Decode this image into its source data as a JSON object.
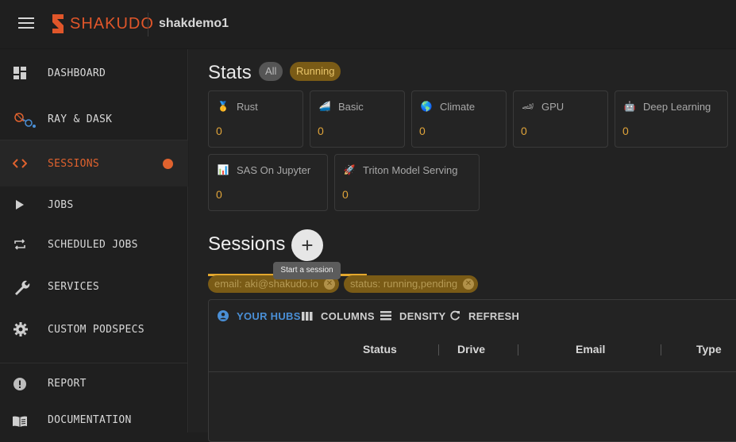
{
  "header": {
    "logo_text": "SHAKUDO",
    "workspace": "shakdemo1"
  },
  "sidebar": {
    "items": [
      {
        "label": "DASHBOARD",
        "icon": "dashboard-icon"
      },
      {
        "label": "RAY & DASK",
        "icon": "ray-dask-icon"
      },
      {
        "label": "SESSIONS",
        "icon": "code-icon",
        "active": true
      },
      {
        "label": "JOBS",
        "icon": "play-icon"
      },
      {
        "label": "SCHEDULED JOBS",
        "icon": "repeat-icon"
      },
      {
        "label": "SERVICES",
        "icon": "wrench-icon"
      },
      {
        "label": "CUSTOM PODSPECS",
        "icon": "gear-icon"
      },
      {
        "label": "REPORT",
        "icon": "alert-icon"
      },
      {
        "label": "DOCUMENTATION",
        "icon": "book-icon"
      }
    ]
  },
  "stats": {
    "title": "Stats",
    "chip_all": "All",
    "chip_running": "Running",
    "cards": [
      {
        "label": "Rust",
        "value": "0",
        "icon": "medal-icon"
      },
      {
        "label": "Basic",
        "value": "0",
        "icon": "train-icon"
      },
      {
        "label": "Climate",
        "value": "0",
        "icon": "globe-icon"
      },
      {
        "label": "GPU",
        "value": "0",
        "icon": "race-car-icon"
      },
      {
        "label": "Deep Learning",
        "value": "0",
        "icon": "robot-icon"
      },
      {
        "label": "SAS On Jupyter",
        "value": "0",
        "icon": "bar-chart-icon"
      },
      {
        "label": "Triton Model Serving",
        "value": "0",
        "icon": "rocket-icon"
      }
    ]
  },
  "sessions": {
    "title": "Sessions",
    "add_symbol": "+",
    "tooltip": "Start a session",
    "filters": [
      {
        "label": "email: aki@shakudo.io"
      },
      {
        "label": "status: running,pending"
      }
    ],
    "toolbar": {
      "hubs": "YOUR HUBS",
      "columns": "COLUMNS",
      "density": "DENSITY",
      "refresh": "REFRESH"
    },
    "columns": [
      "Status",
      "Drive",
      "Email",
      "Type"
    ]
  },
  "colors": {
    "accent": "#e0622e",
    "chip_running": "#7a5b16",
    "stat_value": "#e0a43a",
    "link": "#4a8fd6"
  }
}
